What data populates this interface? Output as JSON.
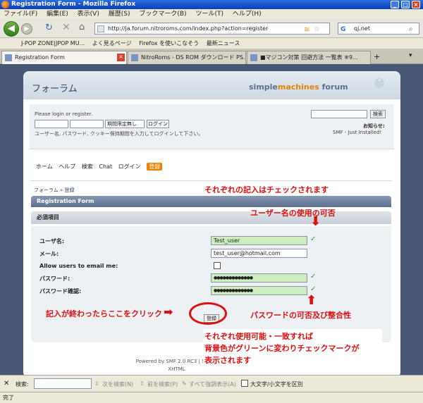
{
  "window": {
    "title": "Registration Form - Mozilla Firefox"
  },
  "menu": [
    "ファイル(F)",
    "編集(E)",
    "表示(V)",
    "履歴(S)",
    "ブックマーク(B)",
    "ツール(T)",
    "ヘルプ(H)"
  ],
  "nav": {
    "url": "http://ja.forum.nitroroms.com/index.php?action=register",
    "search": "qj.net"
  },
  "bookmarks": [
    "J-POP ZONE|JPOP MU...",
    "よく見るページ",
    "Firefox を使いこなそう",
    "最新ニュース"
  ],
  "tabs": [
    {
      "label": "Registration Form"
    },
    {
      "label": "NitroRoms - DS ROM ダウンロード PS..."
    },
    {
      "label": "■マジコン対策 回避方法 一覧表 ※9..."
    }
  ],
  "forum": {
    "title": "フォーラム",
    "logo_main": "simple",
    "logo_accent": "machines",
    "logo_suffix": " forum",
    "login_prompt": "Please login or register.",
    "session_option": "期間限定無し",
    "login_button": "ログイン",
    "login_hint": "ユーザー名, パスワード, クッキー保持期間を入力してログインして下さい。",
    "search_button": "検索",
    "news_label": "お知らせ:",
    "news_text": "SMF - Just Installed!",
    "navlinks": [
      "ホーム",
      "ヘルプ",
      "検索",
      "Chat",
      "ログイン"
    ],
    "nav_register": "登録",
    "breadcrumb": "フォーラム » 登録",
    "form_title": "Registration Form",
    "required_heading": "必須項目",
    "fields": {
      "username_label": "ユーザ名:",
      "username_value": "Test_user",
      "email_label": "メール:",
      "email_value": "test_user@hotmail.com",
      "allow_email_label": "Allow users to email me:",
      "password_label": "パスワード:",
      "password_value": "●●●●●●●●●●●●●",
      "password_confirm_label": "パスワード確認:",
      "password_confirm_value": "●●●●●●●●●●●●●"
    },
    "register_button": "登録",
    "footer_line1": "Powered by SMF 2.0 RC3 | SMF © 2010, Simple Machines LLC",
    "footer_line2": "XHTML"
  },
  "annotations": {
    "note_checked": "それぞれの記入はチェックされます",
    "note_username": "ユーザー名の使用の可否",
    "note_click": "記入が終わったらここをクリック",
    "note_password": "パスワードの可否及び整合性",
    "note_green_1": "それぞれ使用可能・一致すれば",
    "note_green_2": "背景色がグリーンに変わりチェックマークが",
    "note_green_3": "表示されます"
  },
  "findbar": {
    "label": "検索:",
    "next": "次を検索(N)",
    "prev": "前を検索(P)",
    "highlight": "すべて強調表示(A)",
    "matchcase": "大文字/小文字を区別"
  },
  "status": "完了",
  "colors": {
    "valid_field": "#cfeec0",
    "annotation": "#dc1010",
    "accent": "#e98000"
  }
}
